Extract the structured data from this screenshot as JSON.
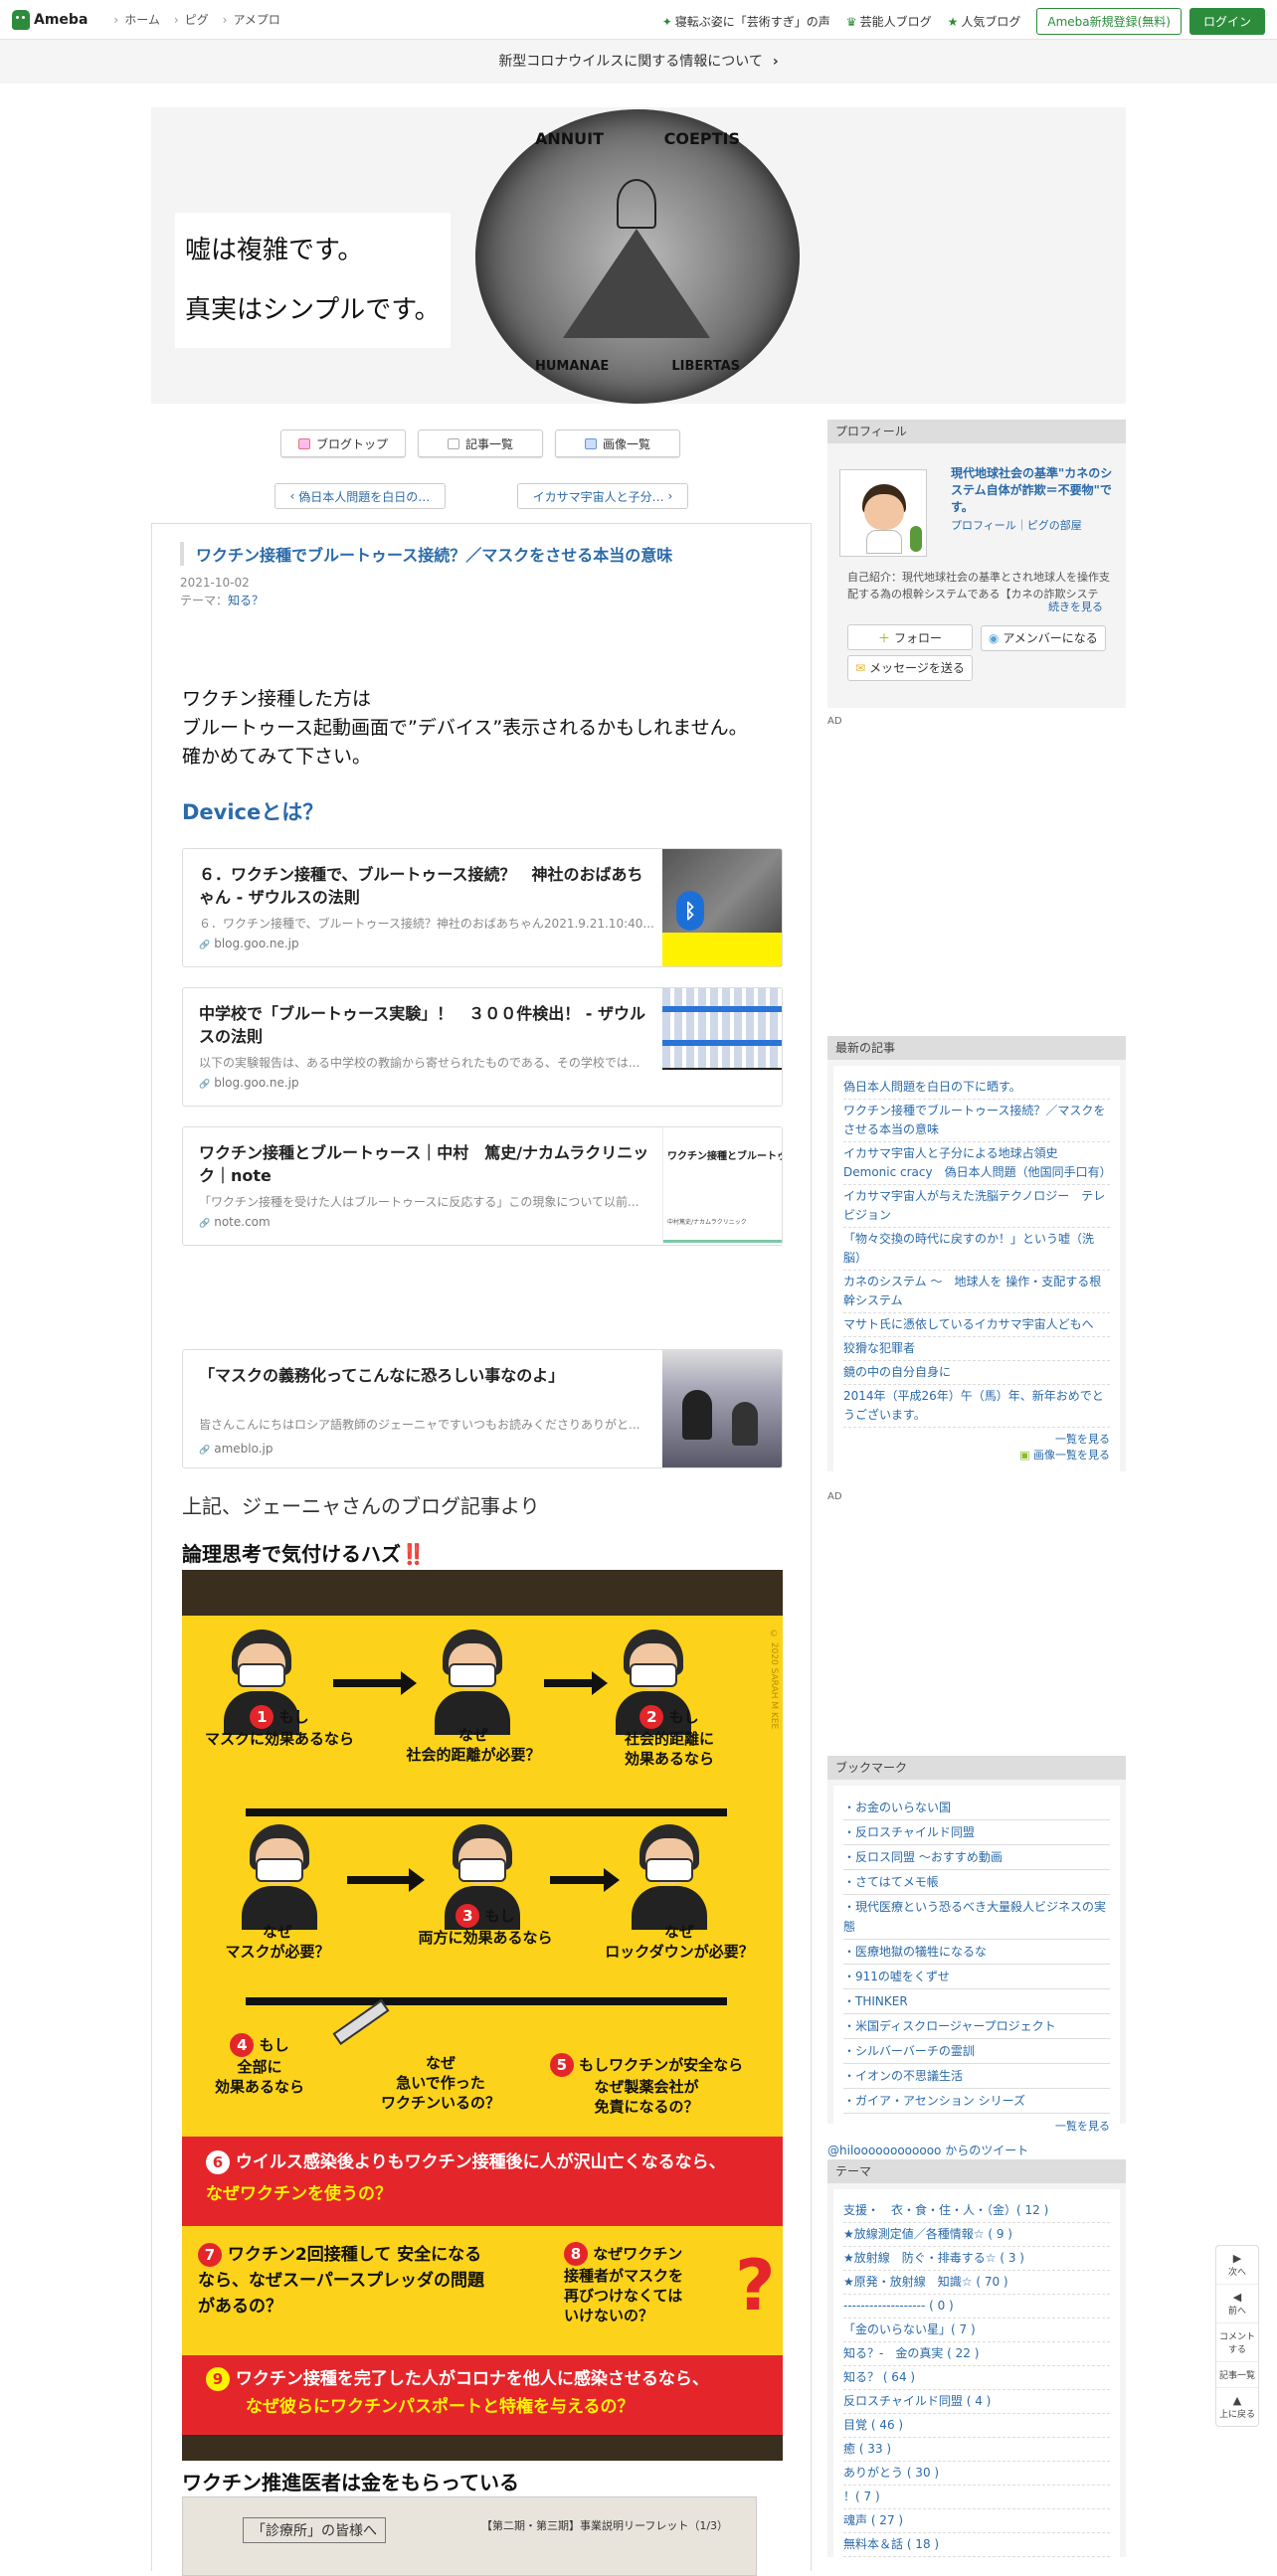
{
  "topbar": {
    "logo": "Ameba",
    "nav": [
      "ホーム",
      "ピグ",
      "アメプロ"
    ],
    "right_links": [
      "寝転ぶ姿に「芸術すぎ」の声",
      "芸能人ブログ",
      "人気ブログ"
    ],
    "register": "Ameba新規登録(無料)",
    "login": "ログイン"
  },
  "covid_notice": "新型コロナウイルスに関する情報について",
  "header": {
    "line1": "嘘は複雑です。",
    "line2": "真実はシンプルです。",
    "seal_top_left": "ANNUIT",
    "seal_top_right": "COEPTIS",
    "seal_bottom_left": "HUMANAE",
    "seal_bottom_right": "LIBERTAS"
  },
  "tabs": [
    "ブログトップ",
    "記事一覧",
    "画像一覧"
  ],
  "pager": {
    "prev": "偽日本人問題を白日の…",
    "next": "イカサマ宇宙人と子分…"
  },
  "article": {
    "title": "ワクチン接種でブルートゥース接続？／マスクをさせる本当の意味",
    "date": "2021-10-02",
    "theme_label": "テーマ：",
    "theme": "知る？",
    "lead1": "ワクチン接種した方は",
    "lead2": "ブルートゥース起動画面で”デバイス”表示されるかもしれません。",
    "lead3": "確かめてみて下さい。",
    "device_heading": "Deviceとは？",
    "cards": [
      {
        "title": "６．ワクチン接種で、ブルートゥース接続？　神社のおばあちゃん - ザウルスの法則",
        "desc": "６．ワクチン接種で、ブルートゥース接続？神社のおばあちゃん2021.9.21.10:40...",
        "source": "blog.goo.ne.jp"
      },
      {
        "title": "中学校で「ブルートゥース実験」！　３００件検出！ - ザウルスの法則",
        "desc": "以下の実験報告は、ある中学校の教諭から寄せられたものである、その学校では...",
        "source": "blog.goo.ne.jp"
      },
      {
        "title": "ワクチン接種とブルートゥース｜中村　篤史/ナカムラクリニック｜note",
        "desc": "「ワクチン接種を受けた人はブルートゥースに反応する」この現象について以前...",
        "source": "note.com",
        "thumb_text": "ワクチン接種とブルートゥース",
        "thumb_sub": "中村篤史/ナカムラクリニック"
      },
      {
        "title": "「マスクの義務化ってこんなに恐ろしい事なのよ」",
        "desc": "皆さんこんにちはロシア語教師のジェーニャですいつもお読みくださりありがと...",
        "source": "ameblo.jp"
      }
    ],
    "source_note": "上記、ジェーニャさんのブログ記事より",
    "logic_heading": "論理思考で気付けるハズ",
    "logic_marks": "‼️",
    "vaccine_doctors": "ワクチン推進医者は金をもらっている",
    "doc_title": "「診療所」の皆様へ",
    "doc_sub": "【第二期・第三期】事業説明リーフレット（1/3）"
  },
  "poster": {
    "row1": [
      {
        "num": "1",
        "tag": "もし",
        "text": "マスクに効果あるなら"
      },
      {
        "num": "",
        "tag": "なぜ",
        "text": "社会的距離が必要？"
      },
      {
        "num": "2",
        "tag": "もし",
        "text": "社会的距離に\n効果あるなら"
      }
    ],
    "row2": [
      {
        "num": "",
        "tag": "なぜ",
        "text": "マスクが必要？"
      },
      {
        "num": "3",
        "tag": "もし",
        "text": "両方に効果あるなら"
      },
      {
        "num": "",
        "tag": "なぜ",
        "text": "ロックダウンが必要？"
      }
    ],
    "q4a": "もし\n全部に\n効果あるなら",
    "q4b": "なぜ\n急いで作った\nワクチンいるの？",
    "q5": "もしワクチンが安全なら\nなぜ製薬会社が\n免責になるの？",
    "q4num": "4",
    "q5num": "5",
    "q6": "ウイルス感染後よりもワクチン接種後に人が沢山亡くなるなら、",
    "q6b": "なぜワクチンを使うの？",
    "q7": "ワクチン2回接種して 安全になる\nなら、なぜスーパースプレッダの問題\nがあるの？",
    "q8": "なぜワクチン\n接種者がマスクを\n再びつけなくては\nいけないの？",
    "q9": "ワクチン接種を完了した人がコロナを他人に感染させるなら、",
    "q9b": "なぜ彼らにワクチンパスポートと特権を与えるの？",
    "q6num": "6",
    "q7num": "7",
    "q8num": "8",
    "q9num": "9",
    "side_text": "© 2020 SARAH M KEE"
  },
  "sidebar": {
    "profile_header": "プロフィール",
    "profile_name": "現代地球社会の基準\"カネのシステム自体が詐欺＝不要物\"です。",
    "profile_links": "プロフィール｜ピグの部屋",
    "profile_intro": "自己紹介：現代地球社会の基準とされ地球人を操作支配する為の根幹システムである【カネの詐欺システム】と複合する...",
    "more": "続きを見る",
    "follow": "フォロー",
    "member": "アメンバーになる",
    "message": "メッセージを送る",
    "ad": "AD",
    "recent_header": "最新の記事",
    "recent": [
      "偽日本人問題を白日の下に晒す。",
      "ワクチン接種でブルートゥース接続？／マスクをさせる本当の意味",
      "イカサマ宇宙人と子分による地球占領史 Demonic cracy　偽日本人問題（他国同手口有）",
      "イカサマ宇宙人が与えた洗脳テクノロジー　テレビジョン",
      "「物々交換の時代に戻すのか！」という嘘（洗脳）",
      "カネのシステム ～　地球人を 操作・支配する根幹システム",
      "マサト氏に憑依しているイカサマ宇宙人どもへ",
      "狡猾な犯罪者",
      "鏡の中の自分自身に",
      "2014年（平成26年）午（馬）年、新年おめでとうございます。"
    ],
    "recent_all": "一覧を見る",
    "images_all": "画像一覧を見る",
    "bookmark_header": "ブックマーク",
    "bookmarks": [
      "・お金のいらない国",
      "・反ロスチャイルド同盟",
      "・反ロス同盟 ～おすすめ動画",
      "・さてはてメモ帳",
      "・現代医療という恐るべき大量殺人ビジネスの実態",
      "・医療地獄の犠牲になるな",
      "・911の嘘をくずせ",
      "・THINKER",
      "・米国ディスクロージャープロジェクト",
      "・シルバーバーチの霊訓",
      "・イオンの不思議生活",
      "・ガイア・アセンション シリーズ"
    ],
    "bookmark_all": "一覧を見る",
    "tweets": "@hiloooooooooooo からのツイート",
    "theme_header": "テーマ",
    "themes": [
      "支援・　衣・食・住・人・（金）( 12 )",
      "★放線測定値／各種情報☆ ( 9 )",
      "★放射線　防ぐ・排毒する☆ ( 3 )",
      "★原発・放射線　知識☆ ( 70 )",
      "------------------- ( 0 )",
      "「金のいらない星」( 7 )",
      "知る？-　金の真実 ( 22 )",
      "知る？ ( 64 )",
      "反ロスチャイルド同盟 ( 4 )",
      "目覚 ( 46 )",
      "癒 ( 33 )",
      "ありがとう ( 30 )",
      "！( 7 )",
      "魂声 ( 27 )",
      "無料本＆話 ( 18 )"
    ]
  },
  "floatnav": [
    "次へ",
    "前へ",
    "コメントする",
    "記事一覧",
    "上に戻る"
  ]
}
